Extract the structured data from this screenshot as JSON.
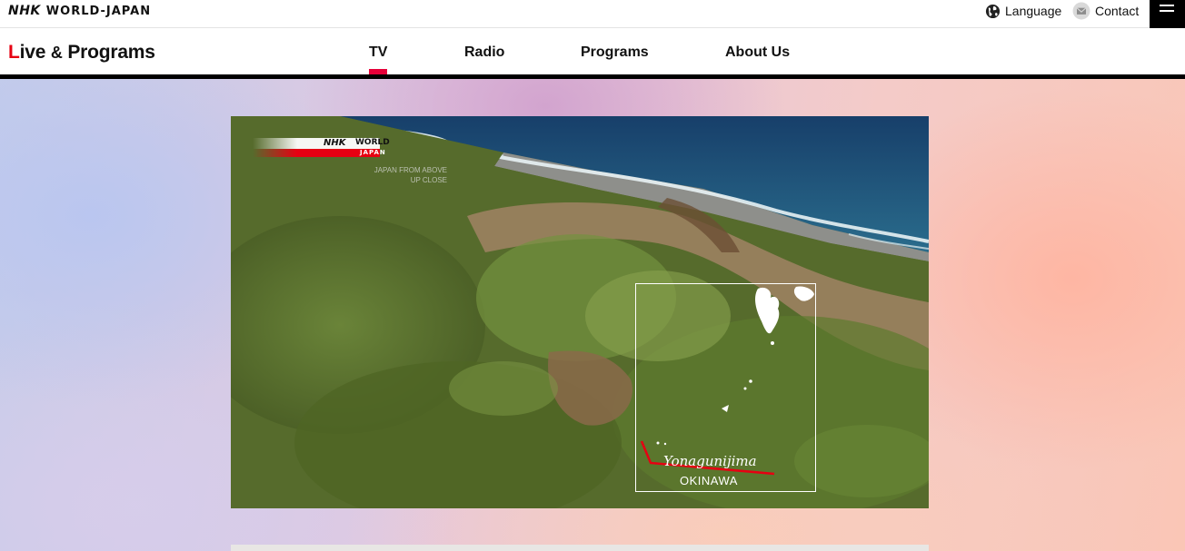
{
  "header": {
    "brand_nhk": "NHK",
    "brand_rest": "WORLD-JAPAN",
    "language_label": "Language",
    "contact_label": "Contact"
  },
  "nav": {
    "section_title_first": "L",
    "section_title_rest": "ive ",
    "section_title_amp": "&",
    "section_title_tail": " Programs",
    "items": [
      {
        "label": "TV",
        "active": true
      },
      {
        "label": "Radio",
        "active": false
      },
      {
        "label": "Programs",
        "active": false
      },
      {
        "label": "About Us",
        "active": false
      }
    ]
  },
  "video": {
    "watermark_nhk": "NHK",
    "watermark_world": "WORLD",
    "watermark_japan": "JAPAN",
    "watermark_caption_line1": "JAPAN FROM ABOVE",
    "watermark_caption_line2": "UP CLOSE",
    "map_place": "Yonagunijima",
    "map_region": "OKINAWA"
  },
  "colors": {
    "accent_red": "#e60012",
    "active_tab": "#e60039"
  },
  "icons": {
    "language": "globe-icon",
    "contact": "envelope-icon",
    "menu": "hamburger-menu-icon"
  }
}
